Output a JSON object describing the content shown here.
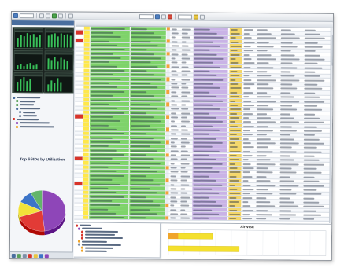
{
  "left_panel": {
    "chart_title": "Top SSIDs by Utilization"
  },
  "lower_panel": {
    "hbar_title": "AirWISE"
  },
  "colors": {
    "panel_header": "#4a6e9e",
    "green_cells": "#7ed36a",
    "purple_cells": "#c9b3e6",
    "alert_red": "#d8342a",
    "bar_yellow": "#f4e02e",
    "bar_orange": "#f0a52a"
  },
  "chart_data": [
    {
      "type": "pie",
      "title": "Top SSIDs by Utilization",
      "values": [
        48,
        22,
        12,
        10,
        8
      ],
      "colors": [
        "#8e46b8",
        "#e23b36",
        "#f2e23a",
        "#3c74c8",
        "#63b56a"
      ]
    },
    {
      "type": "bar",
      "title": "AirWISE",
      "orientation": "horizontal",
      "categories": [
        "",
        ""
      ],
      "values": [
        28,
        45
      ],
      "xlim": [
        0,
        100
      ]
    }
  ]
}
